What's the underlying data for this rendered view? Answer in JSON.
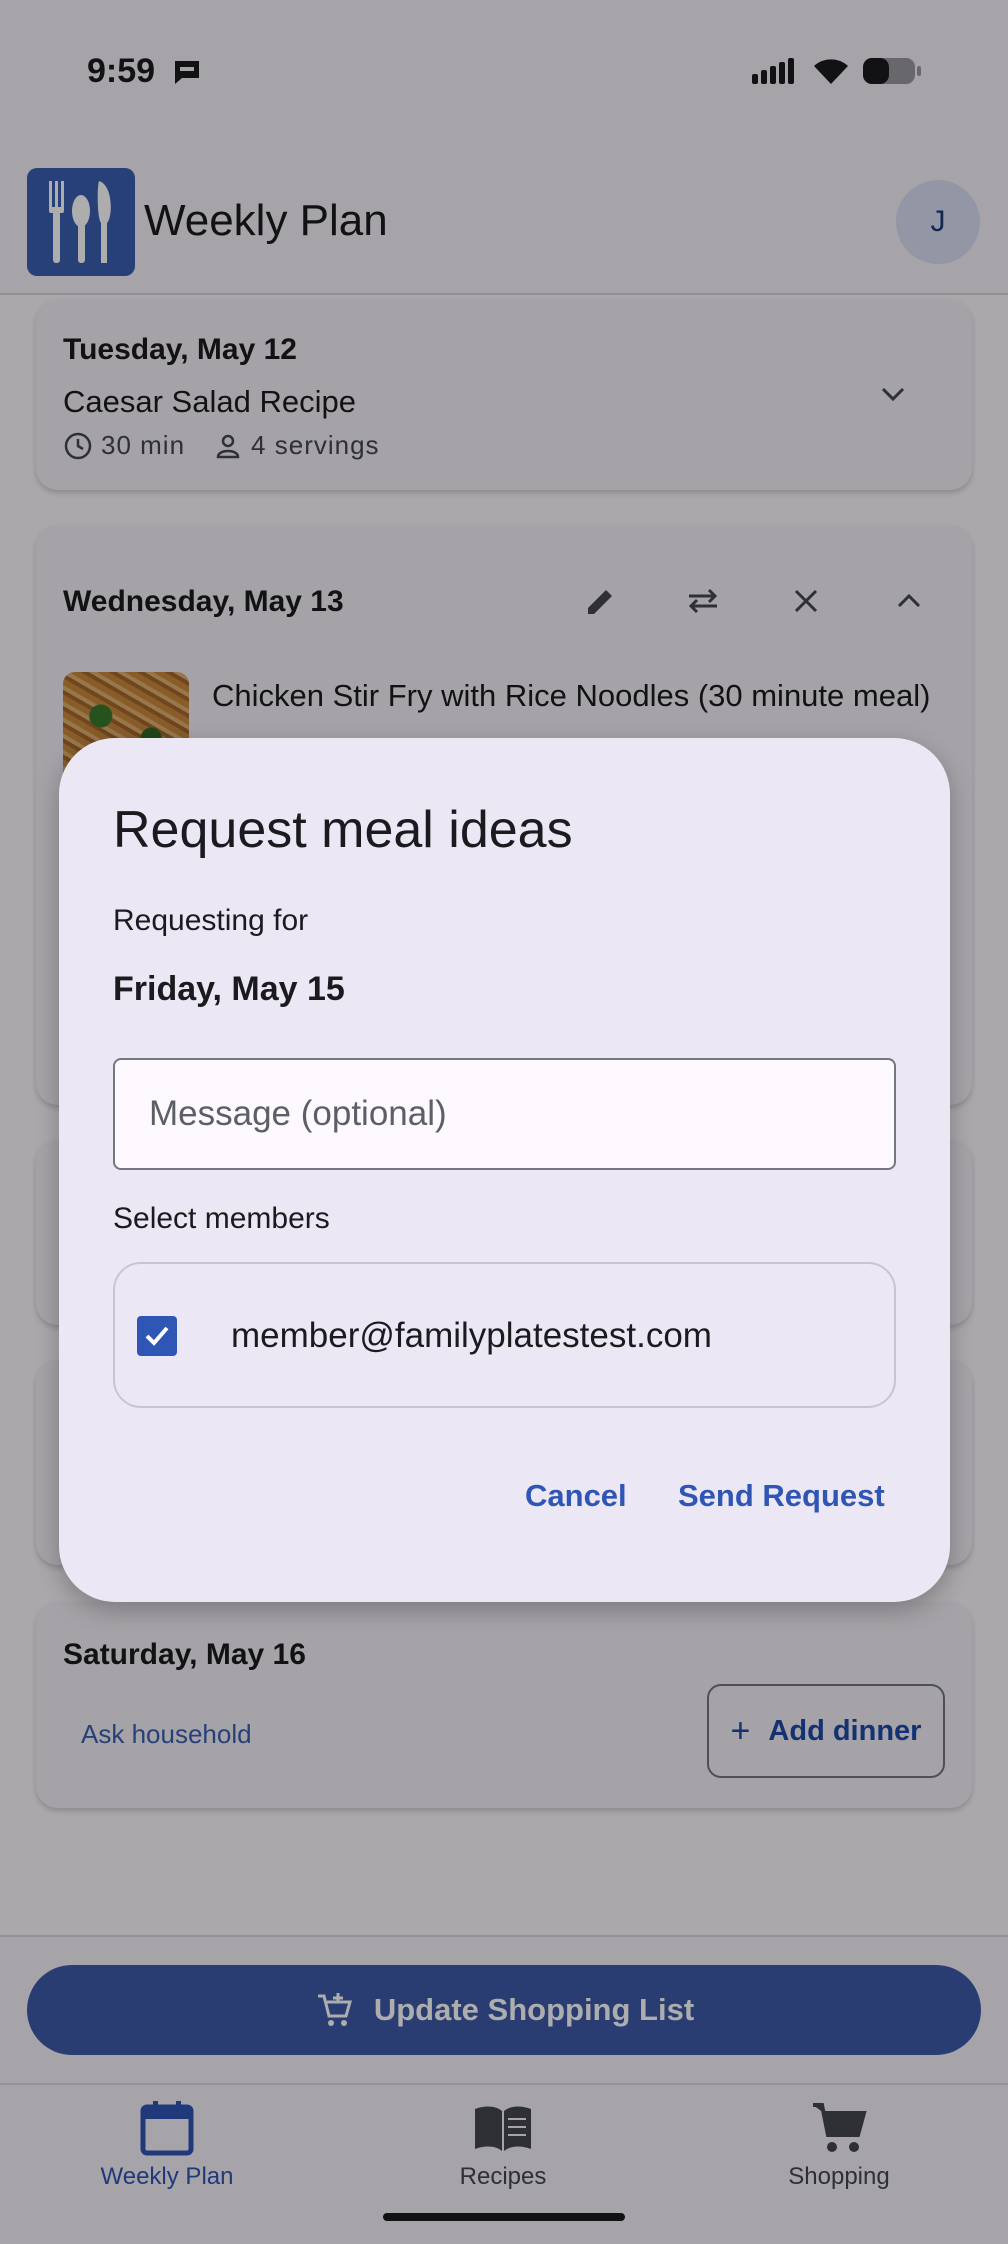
{
  "status_bar": {
    "time": "9:59"
  },
  "app_bar": {
    "title": "Weekly Plan",
    "avatar_initial": "J"
  },
  "days": [
    {
      "date": "Tuesday, May 12",
      "recipe": "Caesar Salad Recipe",
      "time": "30 min",
      "servings": "4 servings"
    },
    {
      "date": "Wednesday, May 13",
      "recipe": "Chicken Stir Fry with Rice Noodles (30 minute meal)"
    },
    {
      "date": "Saturday, May 16",
      "ask_label": "Ask household",
      "add_label": "Add dinner"
    }
  ],
  "bottom": {
    "update_label": "Update Shopping List"
  },
  "nav": {
    "items": [
      {
        "label": "Weekly Plan",
        "icon": "calendar-icon",
        "active": true
      },
      {
        "label": "Recipes",
        "icon": "book-icon",
        "active": false
      },
      {
        "label": "Shopping",
        "icon": "cart-icon",
        "active": false
      }
    ]
  },
  "dialog": {
    "title": "Request meal ideas",
    "requesting_for_label": "Requesting for",
    "requesting_for_date": "Friday, May 15",
    "message_placeholder": "Message (optional)",
    "select_members_label": "Select members",
    "members": [
      {
        "email": "member@familyplatestest.com",
        "checked": true
      }
    ],
    "cancel_label": "Cancel",
    "send_label": "Send Request"
  },
  "colors": {
    "primary": "#2f55b5",
    "button_fill": "#3e5ba9",
    "dialog_bg": "#ece7f4"
  }
}
